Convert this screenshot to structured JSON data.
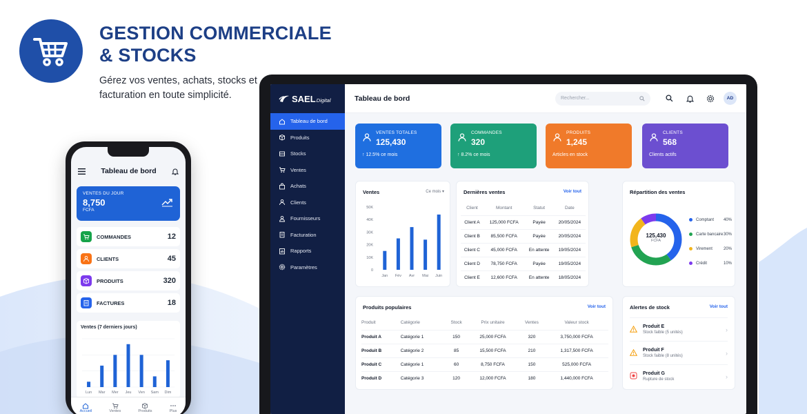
{
  "hero": {
    "title_line1": "GESTION COMMERCIALE",
    "title_line2": "& STOCKS",
    "subtitle": "Gérez vos ventes, achats, stocks et facturation en toute simplicité."
  },
  "phone": {
    "title": "Tableau de bord",
    "hero": {
      "label": "VENTES DU JOUR",
      "value": "8,750",
      "currency": "FCFA"
    },
    "stats": [
      {
        "name": "COMMANDES",
        "value": "12",
        "color": "#16a34a"
      },
      {
        "name": "CLIENTS",
        "value": "45",
        "color": "#f97316"
      },
      {
        "name": "PRODUITS",
        "value": "320",
        "color": "#7c3aed"
      },
      {
        "name": "FACTURES",
        "value": "18",
        "color": "#2563eb"
      }
    ],
    "chart_title": "Ventes (7 derniers jours)",
    "nav": [
      {
        "label": "Accueil",
        "icon": "home-icon"
      },
      {
        "label": "Ventes",
        "icon": "cart-icon"
      },
      {
        "label": "Produits",
        "icon": "box-icon"
      },
      {
        "label": "Plus",
        "icon": "more-icon"
      }
    ]
  },
  "app": {
    "logo_main": "SAEL",
    "logo_sub": "Digital",
    "page_title": "Tableau de bord",
    "search_placeholder": "Rechercher...",
    "avatar": "AD",
    "nav": [
      {
        "label": "Tableau de bord",
        "icon": "home-icon"
      },
      {
        "label": "Produits",
        "icon": "box-icon"
      },
      {
        "label": "Stocks",
        "icon": "stock-icon"
      },
      {
        "label": "Ventes",
        "icon": "cart-icon"
      },
      {
        "label": "Achats",
        "icon": "bag-icon"
      },
      {
        "label": "Clients",
        "icon": "user-icon"
      },
      {
        "label": "Fournisseurs",
        "icon": "supplier-icon"
      },
      {
        "label": "Facturation",
        "icon": "invoice-icon"
      },
      {
        "label": "Rapports",
        "icon": "report-icon"
      },
      {
        "label": "Paramètres",
        "icon": "gear-icon"
      }
    ],
    "kpis": [
      {
        "label": "VENTES TOTALES",
        "prefix": "125,430",
        "value": "125,430",
        "sub": "↑ 12.5% ce mois",
        "color": "#1f6fe0"
      },
      {
        "label": "COMMANDES",
        "value": "320",
        "sub": "↑ 8.2% ce mois",
        "color": "#1ea07a"
      },
      {
        "label": "PRODUITS",
        "value": "1,245",
        "sub": "Articles en stock",
        "color": "#f07a2a"
      },
      {
        "label": "CLIENTS",
        "value": "568",
        "sub": "Clients actifs",
        "color": "#6c4fd0"
      }
    ],
    "ventes_card": {
      "title": "Ventes",
      "period": "Ce mois"
    },
    "recent_sales": {
      "title": "Dernières ventes",
      "link": "Voir tout",
      "headers": [
        "Client",
        "Montant",
        "Statut",
        "Date"
      ],
      "rows": [
        [
          "Client A",
          "125,000 FCFA",
          "Payée",
          "20/05/2024"
        ],
        [
          "Client B",
          "85,500 FCFA",
          "Payée",
          "20/05/2024"
        ],
        [
          "Client C",
          "45,000 FCFA",
          "En attente",
          "19/05/2024"
        ],
        [
          "Client D",
          "78,750 FCFA",
          "Payée",
          "19/05/2024"
        ],
        [
          "Client E",
          "12,600 FCFA",
          "En attente",
          "18/05/2024"
        ]
      ]
    },
    "repartition": {
      "title": "Répartition des ventes",
      "center_value": "125,430",
      "center_unit": "FCFA",
      "items": [
        {
          "name": "Comptant",
          "pct": "40%",
          "color": "#2563eb"
        },
        {
          "name": "Carte bancaire",
          "pct": "30%",
          "color": "#22a352"
        },
        {
          "name": "Virement",
          "pct": "20%",
          "color": "#f2b51c"
        },
        {
          "name": "Crédit",
          "pct": "10%",
          "color": "#7c3aed"
        }
      ]
    },
    "popular": {
      "title": "Produits populaires",
      "link": "Voir tout",
      "headers": [
        "Produit",
        "Catégorie",
        "Stock",
        "Prix unitaire",
        "Ventes",
        "Valeur stock"
      ],
      "rows": [
        [
          "Produit A",
          "Catégorie 1",
          "150",
          "25,000 FCFA",
          "320",
          "3,750,000 FCFA"
        ],
        [
          "Produit B",
          "Catégorie 2",
          "85",
          "15,500 FCFA",
          "210",
          "1,317,500 FCFA"
        ],
        [
          "Produit C",
          "Catégorie 1",
          "60",
          "8,750 FCFA",
          "150",
          "525,000 FCFA"
        ],
        [
          "Produit D",
          "Catégorie 3",
          "120",
          "12,000 FCFA",
          "180",
          "1,440,000 FCFA"
        ]
      ]
    },
    "alerts": {
      "title": "Alertes de stock",
      "link": "Voir tout",
      "items": [
        {
          "name": "Produit E",
          "desc": "Stock faible (5 unités)",
          "color": "#f59e0b"
        },
        {
          "name": "Produit F",
          "desc": "Stock faible (8 unités)",
          "color": "#f59e0b"
        },
        {
          "name": "Produit G",
          "desc": "Rupture de stock",
          "color": "#ef4444"
        }
      ]
    }
  },
  "chart_data": [
    {
      "type": "bar",
      "title": "Ventes",
      "categories": [
        "Jan",
        "Fév",
        "Avr",
        "Mai",
        "Juin"
      ],
      "values": [
        15,
        25,
        34,
        24,
        44
      ],
      "yticks": [
        "0",
        "10K",
        "20K",
        "30K",
        "40K",
        "50K"
      ],
      "ylim": [
        0,
        50
      ],
      "color": "#1f63d6"
    },
    {
      "type": "bar",
      "title": "Ventes (7 derniers jours)",
      "categories": [
        "Lun",
        "Mar",
        "Mer",
        "Jeu",
        "Ven",
        "Sam",
        "Dim"
      ],
      "values": [
        1,
        4,
        6,
        8,
        6,
        2,
        5
      ],
      "ylim": [
        0,
        9
      ],
      "color": "#1f63d6"
    },
    {
      "type": "pie",
      "title": "Répartition des ventes",
      "categories": [
        "Comptant",
        "Carte bancaire",
        "Virement",
        "Crédit"
      ],
      "values": [
        40,
        30,
        20,
        10
      ]
    }
  ]
}
